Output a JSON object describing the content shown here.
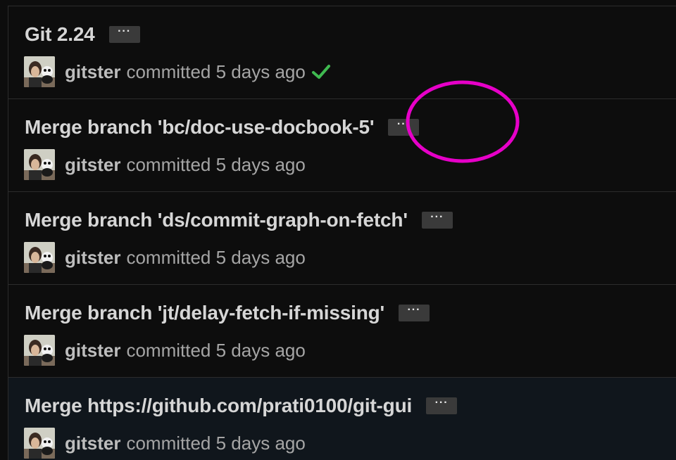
{
  "colors": {
    "background": "#0d0d0d",
    "title_text": "#d6d6d6",
    "meta_text": "#a5a5a5",
    "button_bg": "#3a3a3a",
    "check": "#3fb950",
    "annotation": "#e600c8"
  },
  "commits": [
    {
      "title": "Git 2.24",
      "ellipsis": "···",
      "author": "gitster",
      "when": "committed 5 days ago",
      "status": "check-icon"
    },
    {
      "title": "Merge branch 'bc/doc-use-docbook-5'",
      "ellipsis": "···",
      "author": "gitster",
      "when": "committed 5 days ago"
    },
    {
      "title": "Merge branch 'ds/commit-graph-on-fetch'",
      "ellipsis": "···",
      "author": "gitster",
      "when": "committed 5 days ago"
    },
    {
      "title": "Merge branch 'jt/delay-fetch-if-missing'",
      "ellipsis": "···",
      "author": "gitster",
      "when": "committed 5 days ago"
    },
    {
      "title": "Merge https://github.com/prati0100/git-gui",
      "ellipsis": "···",
      "author": "gitster",
      "when": "committed 5 days ago"
    }
  ]
}
